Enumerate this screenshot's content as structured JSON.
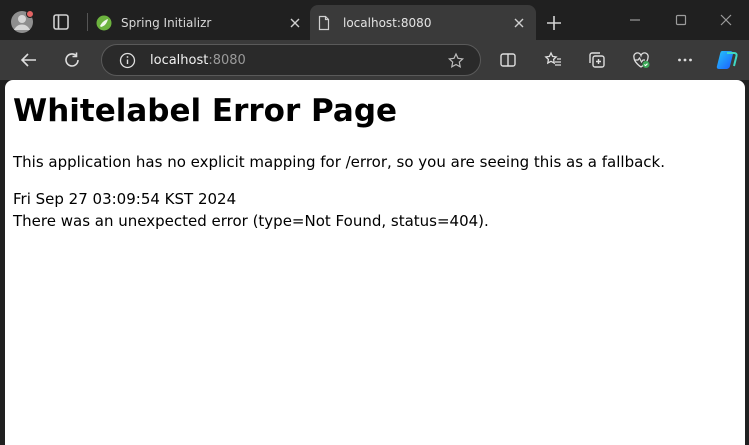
{
  "tabs": [
    {
      "title": "Spring Initializr",
      "active": false,
      "favicon": "spring-icon"
    },
    {
      "title": "localhost:8080",
      "active": true,
      "favicon": "page-icon"
    }
  ],
  "address_bar": {
    "host": "localhost",
    "port": ":8080"
  },
  "page": {
    "heading": "Whitelabel Error Page",
    "message": "This application has no explicit mapping for /error, so you are seeing this as a fallback.",
    "timestamp": "Fri Sep 27 03:09:54 KST 2024",
    "error": "There was an unexpected error (type=Not Found, status=404)."
  },
  "colors": {
    "tabstrip_bg": "#202020",
    "toolbar_bg": "#3a3a3a",
    "page_bg": "#ffffff",
    "spring_green": "#6db33f",
    "copilot_blue": "#1b8cff"
  }
}
